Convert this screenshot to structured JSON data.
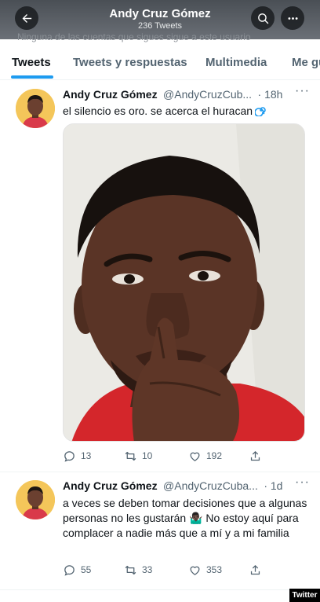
{
  "header": {
    "title": "Andy Cruz Gómez",
    "subtitle": "236 Tweets",
    "strip_text": "Ninguna de las cuentas que sigues sigue a este usuario",
    "back_icon": "arrow-left-icon",
    "search_icon": "search-icon",
    "more_icon": "more-horizontal-icon"
  },
  "tabs": [
    {
      "label": "Tweets",
      "active": true
    },
    {
      "label": "Tweets y respuestas",
      "active": false
    },
    {
      "label": "Multimedia",
      "active": false
    },
    {
      "label": "Me gusta",
      "active": false
    }
  ],
  "tweets": [
    {
      "name": "Andy Cruz Gómez",
      "handle": "@AndyCruzCub...",
      "time": "· 18h",
      "text": "el silencio es oro. se acerca el huracan",
      "emoji": "cyclone-emoji",
      "has_media": true,
      "media_description": "photo-man-finger-on-lips",
      "replies": "13",
      "retweets": "10",
      "likes": "192"
    },
    {
      "name": "Andy Cruz Gómez",
      "handle": "@AndyCruzCuba...",
      "time": "· 1d",
      "text": "a veces se deben tomar decisiones que a algunas personas no les gustarán 🤷🏿‍♂️ No estoy aquí para complacer a nadie más que a mí y a mi familia",
      "has_media": false,
      "replies": "55",
      "retweets": "33",
      "likes": "353"
    }
  ],
  "watermark": "Twitter",
  "colors": {
    "accent": "#1d9bf0",
    "text_primary": "#0f1419",
    "text_secondary": "#536471",
    "header_bg": "#555a60"
  }
}
